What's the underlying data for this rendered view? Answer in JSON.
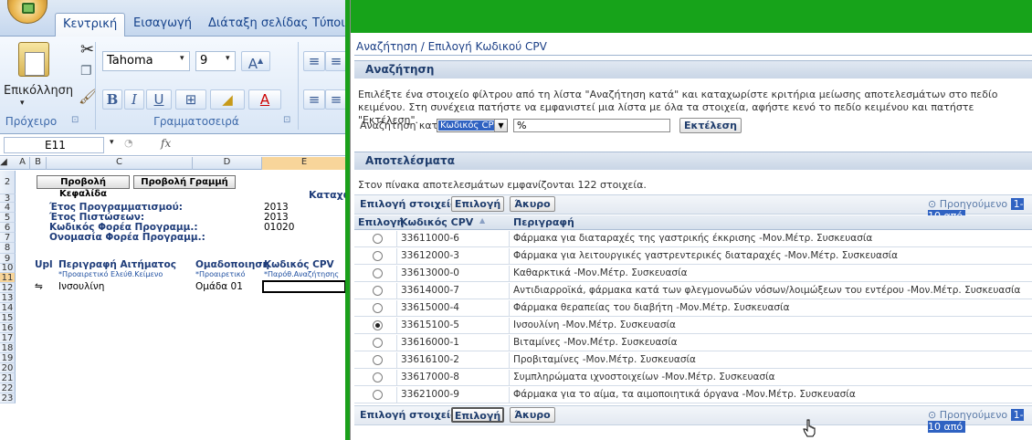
{
  "excel": {
    "tabs": [
      "Κεντρική",
      "Εισαγωγή",
      "Διάταξη σελίδας",
      "Τύποι"
    ],
    "active_tab": "Κεντρική",
    "paste_label": "Επικόλληση",
    "font_name": "Tahoma",
    "font_size": "9",
    "groups": {
      "clipboard": "Πρόχειρο",
      "font": "Γραμματοσειρά"
    },
    "name_box": "E11",
    "fx": "fx",
    "columns": [
      "A",
      "B",
      "C",
      "D",
      "E"
    ],
    "rows": [
      "2",
      "3",
      "4",
      "5",
      "6",
      "7",
      "8",
      "9",
      "10",
      "11",
      "12",
      "13",
      "14",
      "15",
      "16",
      "17",
      "18",
      "19",
      "20",
      "21",
      "22",
      "23"
    ],
    "buttons": {
      "header": "Προβολή Κεφαλίδα",
      "line": "Προβολή Γραμμή"
    },
    "partial_label": "Καταχώ",
    "fields": [
      {
        "label": "Έτος Προγραμματισμού:",
        "value": "2013"
      },
      {
        "label": "Έτος Πιστώσεων:",
        "value": "2013"
      },
      {
        "label": "Κωδικός Φορέα Προγραμμ.:",
        "value": "01020"
      },
      {
        "label": "Ονομασία Φορέα Προγραμμ.:",
        "value": ""
      }
    ],
    "table_headers": {
      "upl": "Upl",
      "description": "Περιγραφή Αιτήματος",
      "description_hint": "*Προαιρετικό Ελεύθ.Κείμενο",
      "group": "Ομαδοποιηση",
      "group_hint": "*Προαιρετικό",
      "cpv": "Κωδικός CPV",
      "cpv_hint": "*Παρόθ.Αναζήτησης"
    },
    "row11": {
      "marker": "⇋",
      "description": "Ινσουλίνη",
      "group": "Ομάδα 01",
      "cpv": ""
    }
  },
  "dialog": {
    "title": "Αναζήτηση / Επιλογή Κωδικού CPV",
    "search_section": "Αναζήτηση",
    "instructions": "Επιλέξτε ένα στοιχείο φίλτρου από τη λίστα \"Αναζήτηση κατά\" και καταχωρίστε κριτήρια μείωσης αποτελεσμάτων στο πεδίο κειμένου. Στη συνέχεια πατήστε να εμφανιστεί μια λίστα με όλα τα στοιχεία, αφήστε κενό το πεδίο κειμένου και πατήστε \"Εκτέλεση\".",
    "search_by_label": "Αναζήτηση κατά",
    "search_by_value": "Κωδικός CPV",
    "search_text": "%",
    "execute_label": "Εκτέλεση",
    "results_section": "Αποτελέσματα",
    "results_count_text": "Στον πίνακα αποτελεσμάτων εμφανίζονται 122 στοιχεία.",
    "toolbar": {
      "label": "Επιλογή στοιχείου",
      "select_label": "Επιλογή",
      "cancel_label": "Άκυρο",
      "prev_label": "Προηγούμενο",
      "range": "1-10 από"
    },
    "columns": {
      "select": "Επιλογή",
      "code": "Κωδικός CPV",
      "description": "Περιγραφή"
    },
    "rows": [
      {
        "code": "33611000-6",
        "description": "Φάρμακα για διαταραχές της γαστρικής έκκρισης -Μον.Μέτρ. Συσκευασία",
        "selected": false
      },
      {
        "code": "33612000-3",
        "description": "Φάρμακα για λειτουργικές γαστρεντερικές διαταραχές -Μον.Μέτρ. Συσκευασία",
        "selected": false
      },
      {
        "code": "33613000-0",
        "description": "Καθαρκτικά -Μον.Μέτρ. Συσκευασία",
        "selected": false
      },
      {
        "code": "33614000-7",
        "description": "Αντιδιαρροϊκά, φάρμακα κατά των φλεγμονωδών νόσων/λοιμώξεων του εντέρου -Μον.Μέτρ. Συσκευασία",
        "selected": false
      },
      {
        "code": "33615000-4",
        "description": "Φάρμακα θεραπείας του διαβήτη -Μον.Μέτρ. Συσκευασία",
        "selected": false
      },
      {
        "code": "33615100-5",
        "description": "Ινσουλίνη -Μον.Μέτρ. Συσκευασία",
        "selected": true
      },
      {
        "code": "33616000-1",
        "description": "Βιταμίνες -Μον.Μέτρ. Συσκευασία",
        "selected": false
      },
      {
        "code": "33616100-2",
        "description": "Προβιταμίνες -Μον.Μέτρ. Συσκευασία",
        "selected": false
      },
      {
        "code": "33617000-8",
        "description": "Συμπληρώματα ιχνοστοιχείων -Μον.Μέτρ. Συσκευασία",
        "selected": false
      },
      {
        "code": "33621000-9",
        "description": "Φάρμακα για το αίμα, τα αιμοποιητικά όργανα -Μον.Μέτρ. Συσκευασία",
        "selected": false
      }
    ],
    "colors": {
      "top_bar": "#17a31a",
      "accent": "#2f62c2"
    }
  }
}
